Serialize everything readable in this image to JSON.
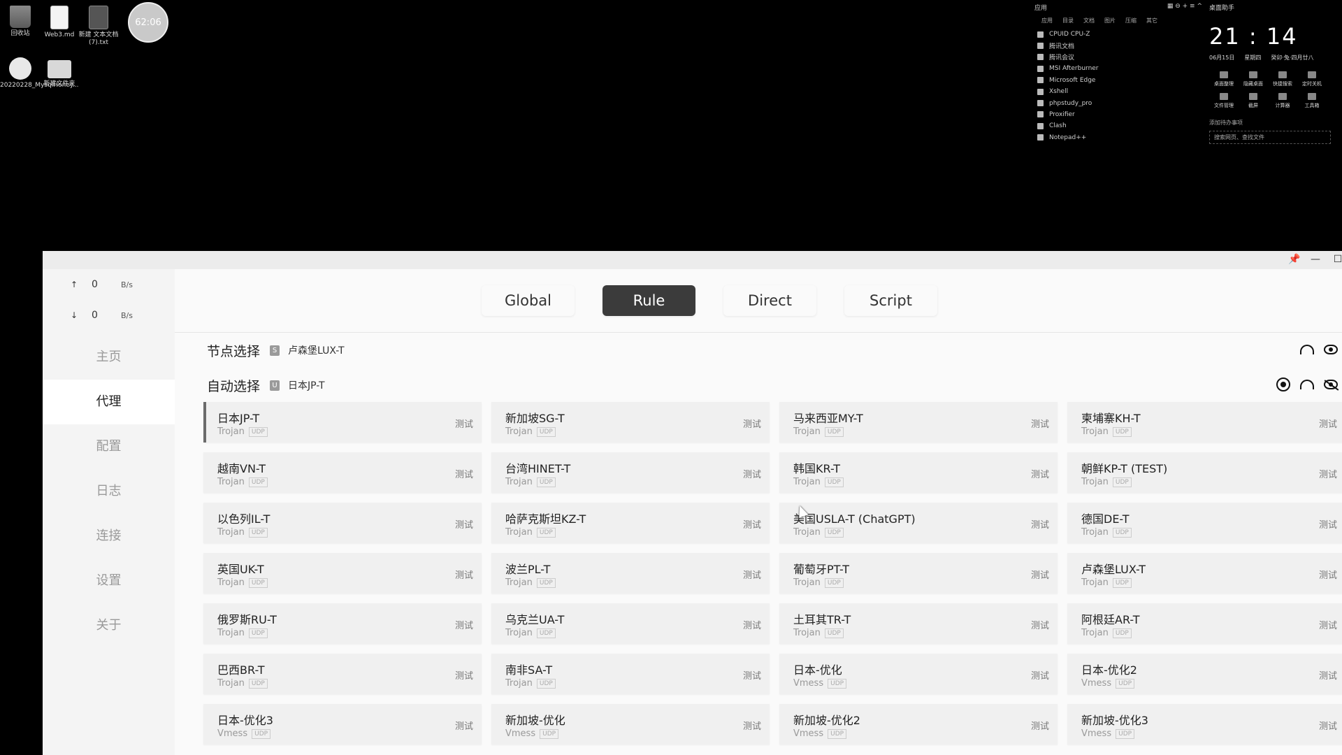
{
  "desktop": {
    "icons": [
      {
        "label": "回收站"
      },
      {
        "label": "Web3.md"
      },
      {
        "label": "新建 文本文档 (7).txt"
      },
      {
        "label": "20220228_MysqlHoney..."
      },
      {
        "label": "新建文件夹"
      }
    ],
    "clock_widget": "62:06",
    "apps_panel": {
      "title": "应用",
      "tabs": [
        "应用",
        "目录",
        "文档",
        "图片",
        "压缩",
        "其它"
      ],
      "items": [
        "CPUID CPU-Z",
        "腾讯文档",
        "腾讯会议",
        "MSI Afterburner",
        "Microsoft Edge",
        "Xshell",
        "phpstudy_pro",
        "Proxifier",
        "Clash",
        "Notepad++"
      ]
    },
    "time_panel": {
      "title": "桌面助手",
      "time": "21 : 14",
      "date": "06月15日",
      "weekday": "星期四",
      "lunar": "癸卯·兔·四月廿八",
      "quick_actions": [
        "桌面整理",
        "隐藏桌面",
        "快捷搜索",
        "定时关机",
        "文件管理",
        "截屏",
        "计算器",
        "工具箱"
      ],
      "reminder": "添加待办事项",
      "search": "搜索网页、查找文件"
    }
  },
  "window": {
    "controls": {
      "pin": "📌",
      "minimize": "—",
      "maximize": "☐"
    },
    "traffic": {
      "up_arrow": "↑",
      "up_value": "0",
      "up_unit": "B/s",
      "down_arrow": "↓",
      "down_value": "0",
      "down_unit": "B/s"
    },
    "nav": [
      {
        "label": "主页"
      },
      {
        "label": "代理",
        "active": true
      },
      {
        "label": "配置"
      },
      {
        "label": "日志"
      },
      {
        "label": "连接"
      },
      {
        "label": "设置"
      },
      {
        "label": "关于"
      }
    ],
    "modes": [
      {
        "label": "Global"
      },
      {
        "label": "Rule",
        "active": true
      },
      {
        "label": "Direct"
      },
      {
        "label": "Script"
      }
    ],
    "groups": [
      {
        "title": "节点选择",
        "badge": "S",
        "value": "卢森堡LUX-T"
      },
      {
        "title": "自动选择",
        "badge": "U",
        "value": "日本JP-T"
      }
    ],
    "test_label": "测试",
    "udp_label": "UDP",
    "proxies": [
      {
        "name": "日本JP-T",
        "type": "Trojan",
        "selected": true
      },
      {
        "name": "新加坡SG-T",
        "type": "Trojan"
      },
      {
        "name": "马来西亚MY-T",
        "type": "Trojan"
      },
      {
        "name": "柬埔寨KH-T",
        "type": "Trojan"
      },
      {
        "name": "越南VN-T",
        "type": "Trojan"
      },
      {
        "name": "台湾HINET-T",
        "type": "Trojan"
      },
      {
        "name": "韩国KR-T",
        "type": "Trojan"
      },
      {
        "name": "朝鲜KP-T (TEST)",
        "type": "Trojan"
      },
      {
        "name": "以色列IL-T",
        "type": "Trojan"
      },
      {
        "name": "哈萨克斯坦KZ-T",
        "type": "Trojan"
      },
      {
        "name": "美国USLA-T (ChatGPT)",
        "type": "Trojan"
      },
      {
        "name": "德国DE-T",
        "type": "Trojan"
      },
      {
        "name": "英国UK-T",
        "type": "Trojan"
      },
      {
        "name": "波兰PL-T",
        "type": "Trojan"
      },
      {
        "name": "葡萄牙PT-T",
        "type": "Trojan"
      },
      {
        "name": "卢森堡LUX-T",
        "type": "Trojan"
      },
      {
        "name": "俄罗斯RU-T",
        "type": "Trojan"
      },
      {
        "name": "乌克兰UA-T",
        "type": "Trojan"
      },
      {
        "name": "土耳其TR-T",
        "type": "Trojan"
      },
      {
        "name": "阿根廷AR-T",
        "type": "Trojan"
      },
      {
        "name": "巴西BR-T",
        "type": "Trojan"
      },
      {
        "name": "南非SA-T",
        "type": "Trojan"
      },
      {
        "name": "日本-优化",
        "type": "Vmess"
      },
      {
        "name": "日本-优化2",
        "type": "Vmess"
      },
      {
        "name": "日本-优化3",
        "type": "Vmess"
      },
      {
        "name": "新加坡-优化",
        "type": "Vmess"
      },
      {
        "name": "新加坡-优化2",
        "type": "Vmess"
      },
      {
        "name": "新加坡-优化3",
        "type": "Vmess"
      }
    ]
  }
}
